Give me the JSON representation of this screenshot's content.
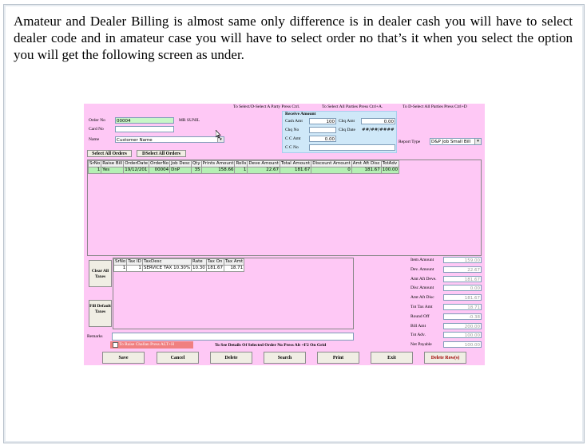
{
  "intro_text": "Amateur and Dealer Billing is almost same only difference is in dealer cash you will have to select dealer code and in amateur case you will have to select order no that’s it when you select the option you will get the following screen as under.",
  "app": {
    "hints": {
      "select_party": "To Select/D-Select A Party Press Ctrl.",
      "select_all": "To Select All Parties Press Ctrl+A.",
      "deselect_all": "To D-Select All Parties Press Ctrl+D"
    },
    "order_no_label": "Order No",
    "order_no_value": "00004",
    "customer_name_display": "MR SUNIL",
    "card_no_label": "Card No",
    "name_label": "Name",
    "name_select_value": "Customer Name",
    "receive": {
      "title": "Receive Amount",
      "cash_amt_label": "Cash Amt",
      "cash_amt_value": "100",
      "chq_amt_label": "Chq Amt",
      "chq_amt_value": "0.00",
      "chq_no_label": "Chq No",
      "chq_date_label": "Chq Date",
      "chq_date_value": "##/##/####",
      "cc_amt_label": "C C Amt",
      "cc_amt_value": "0.00",
      "cc_no_label": "C C No"
    },
    "report_type_label": "Report Type",
    "report_type_value": "D&P Job Small Bill",
    "select_all_orders": "Select All Orders",
    "deselect_all_orders": "DSelect All Orders",
    "orders_table": {
      "headers": [
        "SrNo",
        "Raise Bill",
        "OrderDate",
        "OrderNo",
        "Job Desc",
        "Qty",
        "Prints Amount",
        "Rolls",
        "Deve Amount",
        "Total Amount",
        "Discount Amount",
        "Amt Aft Disc",
        "TotAdv"
      ],
      "rows": [
        [
          "1",
          "Yes",
          "19/12/201",
          "00004",
          "DnP",
          "35",
          "158.66",
          "1",
          "22.67",
          "181.67",
          "0",
          "181.67",
          "100.00"
        ]
      ]
    },
    "clear_all_taxes": "Clear All Taxes",
    "fill_default_taxes": "Fill Default Taxes",
    "tax_table": {
      "headers": [
        "SrNo",
        "Tax ID",
        "TaxDesc",
        "Rate",
        "Tax On",
        "Tax Amt"
      ],
      "rows": [
        [
          "1",
          "1",
          "SERVICE TAX 10.30%",
          "10.30",
          "181.67",
          "18.71"
        ]
      ]
    },
    "totals": [
      {
        "label": "Item Amount",
        "value": "159.00"
      },
      {
        "label": "Dev. Amount",
        "value": "22.67"
      },
      {
        "label": "Amt Aft Deve.",
        "value": "181.67"
      },
      {
        "label": "Disc Amount",
        "value": "0.00"
      },
      {
        "label": "Amt Aft Disc",
        "value": "181.67"
      },
      {
        "label": "Tot Tax Amt",
        "value": "18.71"
      },
      {
        "label": "Round Off",
        "value": "-0.38"
      },
      {
        "label": "Bill Amt",
        "value": "200.00"
      },
      {
        "label": "Tot Adv.",
        "value": "100.00"
      },
      {
        "label": "Net Payable",
        "value": "100.00"
      }
    ],
    "remarks_label": "Remarks",
    "challan_label": "To Raise Challan Press ALT+H",
    "details_hint": "To See Details Of Selected Order No Press Alt +F2 On Grid",
    "buttons": {
      "save": "Save",
      "cancel": "Cancel",
      "delete": "Delete",
      "search": "Search",
      "print": "Print",
      "exit": "Exit",
      "delete_row": "Delete Row(s)"
    },
    "colors": {
      "form_bg": "#fec8f5",
      "selected_row": "#b4f0b4",
      "receive_panel": "#cfe8f8",
      "challan_bg": "#f08080"
    }
  }
}
